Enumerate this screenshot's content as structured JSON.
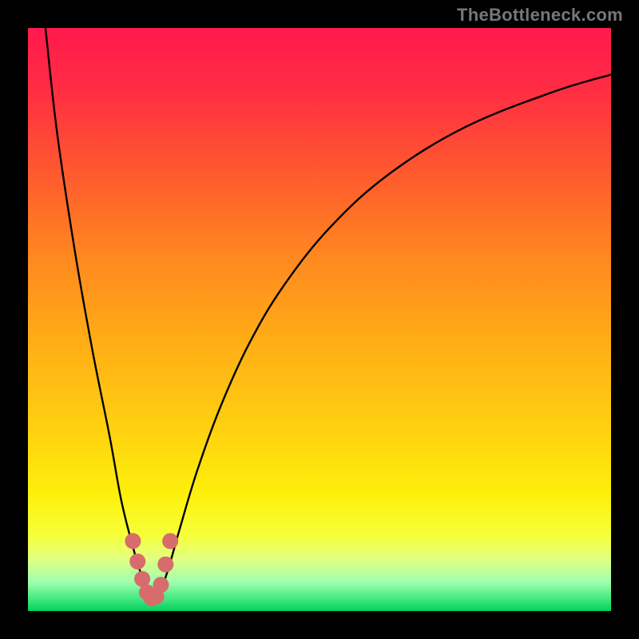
{
  "watermark": "TheBottleneck.com",
  "gradient": {
    "stops": [
      {
        "offset": 0.0,
        "color": "#ff1a4d"
      },
      {
        "offset": 0.1,
        "color": "#ff2b44"
      },
      {
        "offset": 0.25,
        "color": "#ff5a2e"
      },
      {
        "offset": 0.4,
        "color": "#ff8a1f"
      },
      {
        "offset": 0.55,
        "color": "#ffb015"
      },
      {
        "offset": 0.7,
        "color": "#ffd40f"
      },
      {
        "offset": 0.8,
        "color": "#fdf00a"
      },
      {
        "offset": 0.87,
        "color": "#f7ff3a"
      },
      {
        "offset": 0.91,
        "color": "#e0ff80"
      },
      {
        "offset": 0.95,
        "color": "#a0ffb0"
      },
      {
        "offset": 0.98,
        "color": "#40e880"
      },
      {
        "offset": 1.0,
        "color": "#00d060"
      }
    ]
  },
  "chart_data": {
    "type": "line",
    "title": "",
    "xlabel": "",
    "ylabel": "",
    "xlim": [
      0,
      100
    ],
    "ylim": [
      0,
      100
    ],
    "series": [
      {
        "name": "bottleneck-curve",
        "x": [
          3,
          5,
          8,
          11,
          14,
          16,
          18,
          19.5,
          20.5,
          21.5,
          22.5,
          24,
          26,
          29,
          33,
          38,
          44,
          52,
          62,
          75,
          90,
          100
        ],
        "y": [
          100,
          82,
          62,
          45,
          30,
          19,
          11,
          6,
          3,
          2,
          3,
          7,
          14,
          24,
          35,
          46,
          56,
          66,
          75,
          83,
          89,
          92
        ]
      }
    ],
    "markers": {
      "name": "optimal-zone",
      "color": "#d86b6b",
      "points": [
        {
          "x": 18.0,
          "y": 12.0
        },
        {
          "x": 18.8,
          "y": 8.5
        },
        {
          "x": 19.6,
          "y": 5.5
        },
        {
          "x": 20.4,
          "y": 3.2
        },
        {
          "x": 21.2,
          "y": 2.2
        },
        {
          "x": 22.0,
          "y": 2.5
        },
        {
          "x": 22.8,
          "y": 4.5
        },
        {
          "x": 23.6,
          "y": 8.0
        },
        {
          "x": 24.4,
          "y": 12.0
        }
      ]
    }
  }
}
